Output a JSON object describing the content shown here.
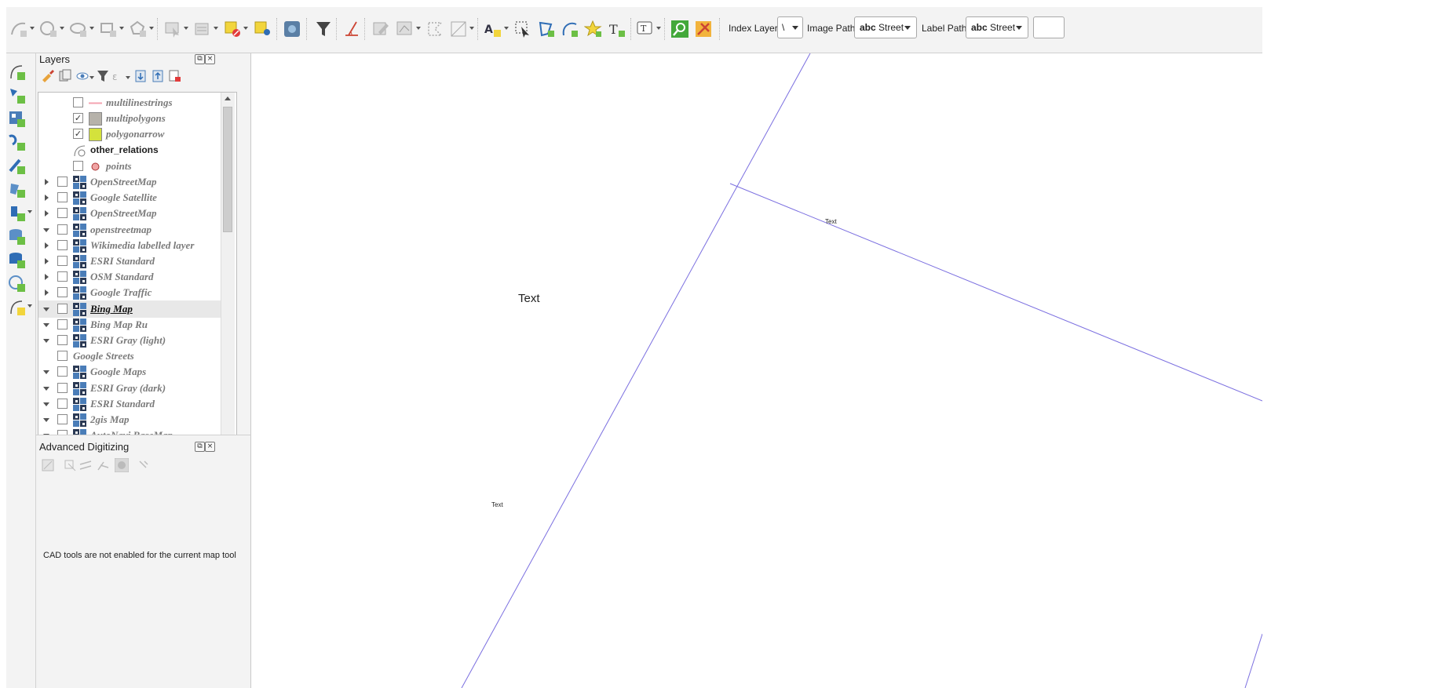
{
  "toolbar": {
    "index_layer_label": "Index Layer",
    "index_layer_value": "\\",
    "image_path_label": "Image Path",
    "image_path_value_prefix": "abc",
    "image_path_value": "Street",
    "label_path_label": "Label Path",
    "label_path_value_prefix": "abc",
    "label_path_value": "Street"
  },
  "layers_panel": {
    "title": "Layers",
    "items": [
      {
        "label": "multilinestrings",
        "checked": false,
        "symbol": "line",
        "color": "#f4a3b0",
        "indent": 2
      },
      {
        "label": "multipolygons",
        "checked": true,
        "symbol": "fill",
        "color": "#b6b2aa",
        "indent": 2
      },
      {
        "label": "polygonarrow",
        "checked": true,
        "symbol": "fill",
        "color": "#d4e23c",
        "indent": 2
      },
      {
        "label": "other_relations",
        "checked": null,
        "symbol": "geom",
        "indent": 1
      },
      {
        "label": "points",
        "checked": false,
        "symbol": "point",
        "color": "#f0a3a3",
        "indent": 2
      },
      {
        "label": "OpenStreetMap",
        "checked": false,
        "symbol": "tile",
        "expander": "right"
      },
      {
        "label": "Google Satellite",
        "checked": false,
        "symbol": "tile",
        "expander": "right"
      },
      {
        "label": "OpenStreetMap",
        "checked": false,
        "symbol": "tile",
        "expander": "right"
      },
      {
        "label": "openstreetmap",
        "checked": false,
        "symbol": "tile",
        "expander": "down"
      },
      {
        "label": "Wikimedia labelled layer",
        "checked": false,
        "symbol": "tile",
        "expander": "right"
      },
      {
        "label": "ESRI Standard",
        "checked": false,
        "symbol": "tile",
        "expander": "right"
      },
      {
        "label": "OSM Standard",
        "checked": false,
        "symbol": "tile",
        "expander": "right"
      },
      {
        "label": "Google Traffic",
        "checked": false,
        "symbol": "tile",
        "expander": "right"
      },
      {
        "label": "Bing Map",
        "checked": false,
        "symbol": "tile",
        "expander": "down",
        "selected": true
      },
      {
        "label": "Bing Map Ru",
        "checked": false,
        "symbol": "tile",
        "expander": "down"
      },
      {
        "label": "ESRI Gray (light)",
        "checked": false,
        "symbol": "tile",
        "expander": "down"
      },
      {
        "label": "Google Streets",
        "checked": false,
        "symbol": "none",
        "expander": "none"
      },
      {
        "label": "Google Maps",
        "checked": false,
        "symbol": "tile",
        "expander": "down"
      },
      {
        "label": "ESRI Gray (dark)",
        "checked": false,
        "symbol": "tile",
        "expander": "down"
      },
      {
        "label": "ESRI Standard",
        "checked": false,
        "symbol": "tile",
        "expander": "down"
      },
      {
        "label": "2gis Map",
        "checked": false,
        "symbol": "tile",
        "expander": "down"
      },
      {
        "label": "AutoNavi BaseMap",
        "checked": false,
        "symbol": "tile",
        "expander": "down"
      }
    ]
  },
  "advanced_digitizing": {
    "title": "Advanced Digitizing",
    "message": "CAD tools are not enabled for the current map tool"
  },
  "map": {
    "label_large": "Text",
    "label_small_1": "Text",
    "label_small_2": "Text",
    "line_color": "#7b6fe0"
  }
}
